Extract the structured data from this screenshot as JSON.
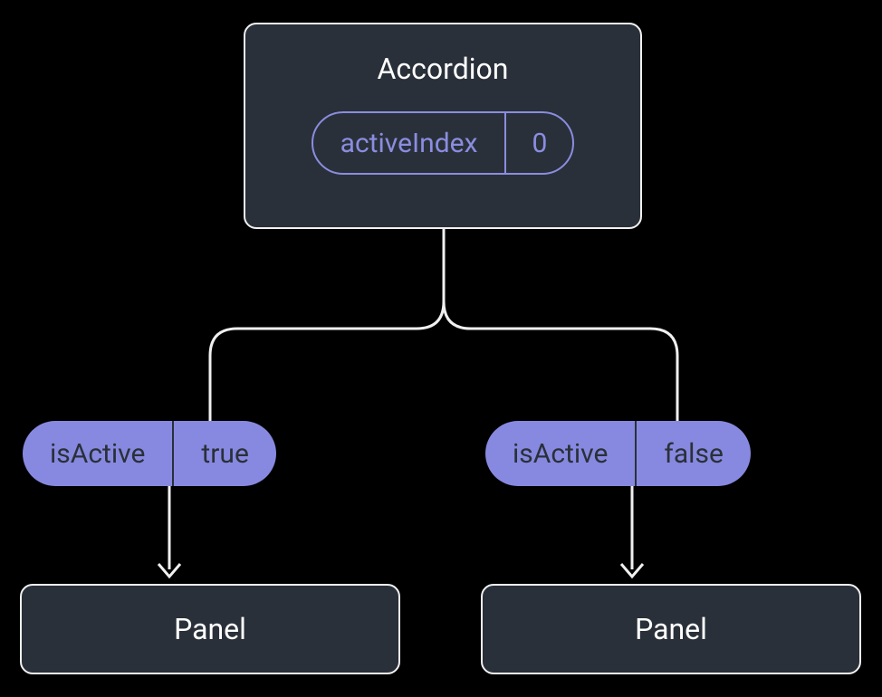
{
  "root": {
    "title": "Accordion",
    "state": {
      "name": "activeIndex",
      "value": "0"
    }
  },
  "children": [
    {
      "prop": {
        "name": "isActive",
        "value": "true"
      },
      "label": "Panel"
    },
    {
      "prop": {
        "name": "isActive",
        "value": "false"
      },
      "label": "Panel"
    }
  ]
}
